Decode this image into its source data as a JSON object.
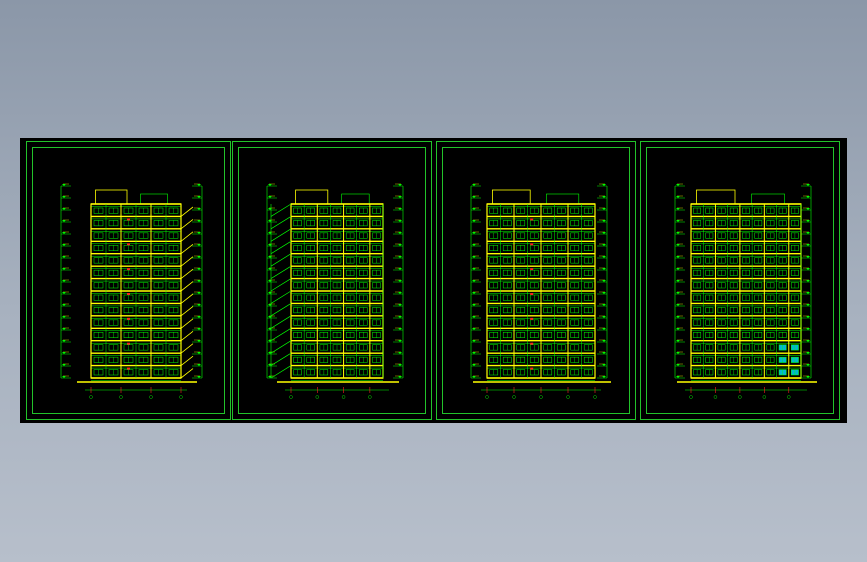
{
  "colors": {
    "background_top": "#8b97a8",
    "background_bottom": "#b7bfcb",
    "canvas": "#000000",
    "frame": "#22c32a",
    "structure": "#ffff00",
    "grid_lines": "#00ff00",
    "red_marks": "#ff2020",
    "glass": "#00e5ff"
  },
  "sheets": [
    {
      "id": "sheet-1",
      "view": "side-elevation-with-balconies",
      "caption": ""
    },
    {
      "id": "sheet-2",
      "view": "section-with-stairs",
      "caption": ""
    },
    {
      "id": "sheet-3",
      "view": "front-elevation",
      "caption": ""
    },
    {
      "id": "sheet-4",
      "view": "rear-elevation",
      "caption": ""
    }
  ]
}
